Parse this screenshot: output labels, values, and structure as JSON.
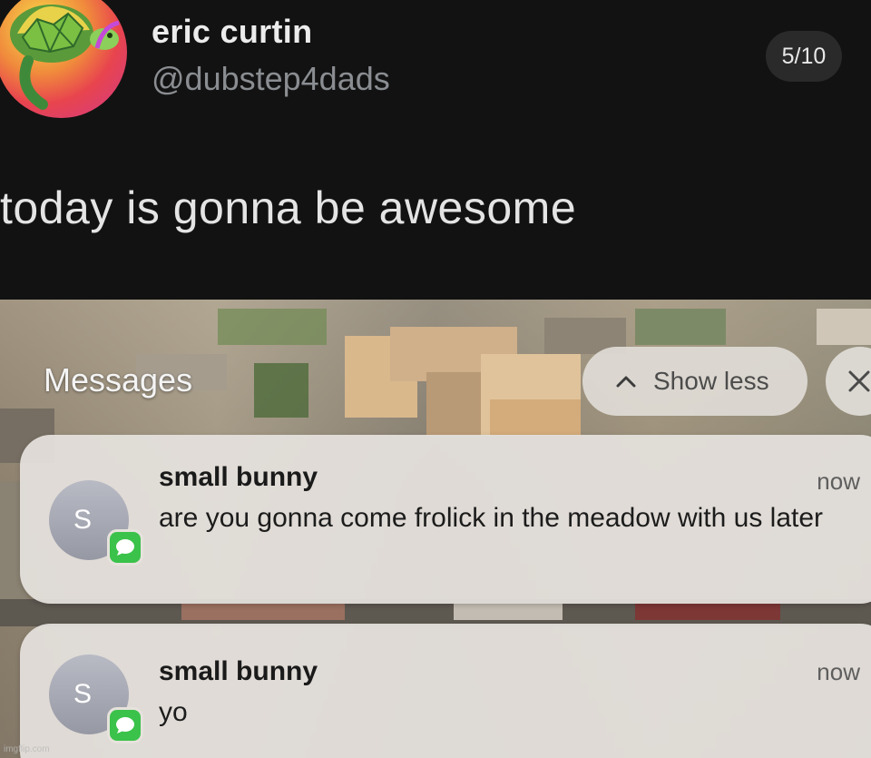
{
  "tweet": {
    "author_name": "eric curtin",
    "author_handle": "@dubstep4dads",
    "image_counter": "5/10",
    "text": "today is gonna be awesome",
    "avatar_icon": "turtle-icon"
  },
  "lockscreen": {
    "group_title": "Messages",
    "show_less_label": "Show less",
    "show_less_icon": "chevron-up-icon",
    "close_icon": "close-icon",
    "notifications": [
      {
        "sender": "small bunny",
        "avatar_initial": "S",
        "time": "now",
        "body": "are you gonna come frolick in the meadow with us later",
        "app_icon": "messages-app-icon"
      },
      {
        "sender": "small bunny",
        "avatar_initial": "S",
        "time": "now",
        "body": "yo",
        "app_icon": "messages-app-icon"
      }
    ]
  },
  "watermark": "imgflip.com",
  "colors": {
    "background": "#121212",
    "notification_bg": "#e4e0dc",
    "messages_green": "#3ac24a"
  }
}
